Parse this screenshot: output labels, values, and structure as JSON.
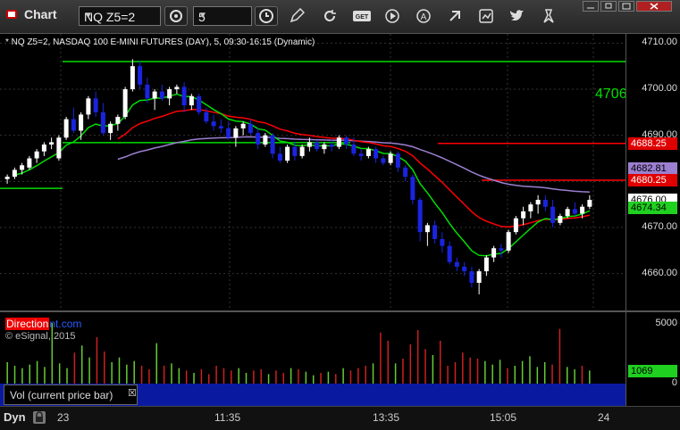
{
  "window": {
    "title": "Chart"
  },
  "toolbar": {
    "symbol": "NQ Z5=2",
    "interval": "5"
  },
  "chart": {
    "header": "* NQ Z5=2, NASDAQ 100 E-MINI FUTURES (DAY), 5, 09:30-16:15 (Dynamic)",
    "price_ticks": [
      "4710.00",
      "4700.00",
      "4690.00",
      "4680.00",
      "4670.00",
      "4660.00"
    ],
    "level_big_label": "4706",
    "tags": [
      {
        "text": "4688.25",
        "bg": "#e00000",
        "fg": "#ffffff"
      },
      {
        "text": "4682.81",
        "bg": "#9c7fd0",
        "fg": "#000000"
      },
      {
        "text": "4680.25",
        "bg": "#e00000",
        "fg": "#ffffff"
      },
      {
        "text": "4676.00",
        "bg": "#ffffff",
        "fg": "#000000"
      },
      {
        "text": "4674.34",
        "bg": "#20d020",
        "fg": "#000000"
      }
    ],
    "watermark_a": "Direction",
    "watermark_b": "nt.com",
    "copyright": "© eSignal, 2015"
  },
  "volume": {
    "label": "Vol (current price bar)",
    "ticks": [
      "5000",
      "0"
    ],
    "current": "1069"
  },
  "time_axis": {
    "mode": "Dyn",
    "labels": [
      "23",
      "11:35",
      "13:35",
      "15:05",
      "24"
    ]
  },
  "colors": {
    "up_candle": "#ffffff",
    "down_candle": "#1a24e0",
    "red_line": "#ff0000",
    "green_line": "#00dd00",
    "purple_line": "#9c7fd0"
  },
  "chart_data": {
    "type": "candlestick",
    "y_range": [
      4652,
      4712
    ],
    "candles": [
      [
        4680.5,
        4681.5,
        4679.5,
        4681.0
      ],
      [
        4681.0,
        4683.0,
        4680.5,
        4682.5
      ],
      [
        4682.5,
        4684.0,
        4681.5,
        4683.5
      ],
      [
        4683.0,
        4685.5,
        4682.5,
        4685.0
      ],
      [
        4685.0,
        4687.0,
        4684.0,
        4686.5
      ],
      [
        4686.5,
        4688.5,
        4685.5,
        4688.0
      ],
      [
        4688.0,
        4689.5,
        4687.0,
        4688.5
      ],
      [
        4685.0,
        4690.0,
        4684.5,
        4689.5
      ],
      [
        4689.5,
        4694.0,
        4689.0,
        4693.5
      ],
      [
        4693.5,
        4696.0,
        4690.5,
        4691.0
      ],
      [
        4691.0,
        4695.0,
        4689.0,
        4694.5
      ],
      [
        4694.5,
        4698.5,
        4693.5,
        4698.0
      ],
      [
        4698.0,
        4699.5,
        4694.0,
        4695.0
      ],
      [
        4695.0,
        4697.0,
        4690.0,
        4690.5
      ],
      [
        4690.5,
        4693.0,
        4689.0,
        4692.5
      ],
      [
        4692.5,
        4694.5,
        4691.0,
        4694.0
      ],
      [
        4694.0,
        4700.5,
        4693.5,
        4700.0
      ],
      [
        4700.0,
        4706.5,
        4699.5,
        4705.0
      ],
      [
        4705.0,
        4706.0,
        4700.0,
        4701.0
      ],
      [
        4701.0,
        4702.5,
        4697.0,
        4698.0
      ],
      [
        4698.0,
        4700.0,
        4695.5,
        4699.5
      ],
      [
        4699.5,
        4701.0,
        4697.5,
        4698.0
      ],
      [
        4698.0,
        4700.5,
        4696.5,
        4700.0
      ],
      [
        4700.0,
        4701.0,
        4699.0,
        4700.5
      ],
      [
        4700.5,
        4701.5,
        4695.0,
        4696.5
      ],
      [
        4696.5,
        4699.0,
        4695.5,
        4698.5
      ],
      [
        4698.5,
        4699.0,
        4694.5,
        4695.0
      ],
      [
        4695.0,
        4696.0,
        4692.5,
        4693.0
      ],
      [
        4693.0,
        4694.5,
        4691.0,
        4692.0
      ],
      [
        4692.0,
        4693.5,
        4690.5,
        4691.5
      ],
      [
        4691.5,
        4693.0,
        4689.0,
        4689.5
      ],
      [
        4689.5,
        4692.0,
        4687.5,
        4691.5
      ],
      [
        4691.5,
        4693.0,
        4690.0,
        4692.5
      ],
      [
        4692.5,
        4693.5,
        4690.0,
        4690.5
      ],
      [
        4690.5,
        4691.5,
        4687.0,
        4688.0
      ],
      [
        4688.0,
        4690.5,
        4687.5,
        4690.0
      ],
      [
        4690.0,
        4690.5,
        4685.0,
        4686.0
      ],
      [
        4686.0,
        4687.5,
        4684.0,
        4684.5
      ],
      [
        4684.5,
        4688.0,
        4684.0,
        4687.5
      ],
      [
        4687.5,
        4688.5,
        4684.5,
        4685.5
      ],
      [
        4685.5,
        4688.0,
        4685.0,
        4687.5
      ],
      [
        4687.5,
        4689.5,
        4686.5,
        4688.5
      ],
      [
        4688.5,
        4689.0,
        4686.5,
        4687.0
      ],
      [
        4687.0,
        4688.5,
        4686.0,
        4688.0
      ],
      [
        4688.0,
        4689.0,
        4686.5,
        4687.5
      ],
      [
        4687.5,
        4690.0,
        4687.0,
        4689.5
      ],
      [
        4689.5,
        4690.0,
        4687.0,
        4688.0
      ],
      [
        4688.0,
        4689.5,
        4685.5,
        4686.0
      ],
      [
        4686.0,
        4687.0,
        4684.5,
        4685.5
      ],
      [
        4685.5,
        4687.5,
        4685.0,
        4687.0
      ],
      [
        4687.0,
        4687.5,
        4684.0,
        4685.0
      ],
      [
        4685.0,
        4685.5,
        4683.5,
        4684.0
      ],
      [
        4684.0,
        4686.5,
        4683.5,
        4686.0
      ],
      [
        4686.0,
        4686.5,
        4682.0,
        4683.0
      ],
      [
        4683.0,
        4683.5,
        4680.0,
        4681.0
      ],
      [
        4681.0,
        4681.5,
        4675.0,
        4676.0
      ],
      [
        4676.0,
        4676.5,
        4667.0,
        4669.0
      ],
      [
        4669.0,
        4671.0,
        4666.0,
        4670.5
      ],
      [
        4670.5,
        4671.5,
        4666.5,
        4667.5
      ],
      [
        4667.5,
        4669.0,
        4664.5,
        4666.0
      ],
      [
        4666.0,
        4667.0,
        4662.0,
        4662.5
      ],
      [
        4662.5,
        4663.5,
        4660.5,
        4661.5
      ],
      [
        4661.5,
        4662.5,
        4659.5,
        4660.5
      ],
      [
        4660.5,
        4661.5,
        4657.0,
        4658.0
      ],
      [
        4658.0,
        4661.0,
        4655.5,
        4660.5
      ],
      [
        4660.5,
        4664.0,
        4659.5,
        4663.5
      ],
      [
        4663.5,
        4666.0,
        4662.5,
        4665.5
      ],
      [
        4665.5,
        4666.5,
        4663.5,
        4665.0
      ],
      [
        4665.0,
        4669.5,
        4664.5,
        4669.0
      ],
      [
        4669.0,
        4672.5,
        4668.5,
        4672.0
      ],
      [
        4672.0,
        4674.5,
        4670.5,
        4673.5
      ],
      [
        4673.5,
        4675.5,
        4672.0,
        4675.0
      ],
      [
        4675.0,
        4677.0,
        4673.0,
        4676.0
      ],
      [
        4676.0,
        4677.0,
        4673.5,
        4674.5
      ],
      [
        4674.5,
        4676.0,
        4670.0,
        4671.0
      ],
      [
        4671.0,
        4673.0,
        4670.5,
        4672.5
      ],
      [
        4672.5,
        4674.5,
        4672.0,
        4674.0
      ],
      [
        4674.0,
        4675.5,
        4672.5,
        4673.0
      ],
      [
        4673.0,
        4675.0,
        4672.0,
        4674.5
      ],
      [
        4674.5,
        4677.0,
        4674.0,
        4676.0
      ]
    ],
    "levels": [
      {
        "value": 4706,
        "color": "#00dd00",
        "from": 0.1,
        "to": 1.0
      },
      {
        "value": 4688.25,
        "color": "#ff0000",
        "from": 0.7,
        "to": 1.0
      },
      {
        "value": 4680.25,
        "color": "#ff0000",
        "from": 0.77,
        "to": 1.0
      },
      {
        "value": 4688.4,
        "color": "#00dd00",
        "from": 0.1,
        "to": 0.56
      },
      {
        "value": 4678.5,
        "color": "#00dd00",
        "from": 0.0,
        "to": 0.1
      }
    ],
    "volume": [
      1800,
      1500,
      1300,
      1600,
      1900,
      1400,
      5100,
      1700,
      1300,
      2600,
      3200,
      2200,
      3900,
      2700,
      1800,
      2200,
      1600,
      1900,
      1500,
      1200,
      3400,
      1500,
      1700,
      1300,
      1100,
      900,
      1200,
      800,
      1500,
      1300,
      1100,
      1300,
      900,
      1100,
      1200,
      800,
      1100,
      900,
      1300,
      1200,
      1000,
      700,
      900,
      1000,
      800,
      1300,
      1100,
      1300,
      1500,
      1700,
      4300,
      3600,
      1700,
      2100,
      3300,
      4500,
      2900,
      2400,
      3600,
      1500,
      1800,
      2600,
      2200,
      2100,
      1900,
      1600,
      2000,
      1300,
      1500,
      1900,
      2300,
      1400,
      1800,
      1600,
      4600,
      1400,
      1200,
      1500,
      1100
    ],
    "volume_range": [
      0,
      6000
    ]
  }
}
